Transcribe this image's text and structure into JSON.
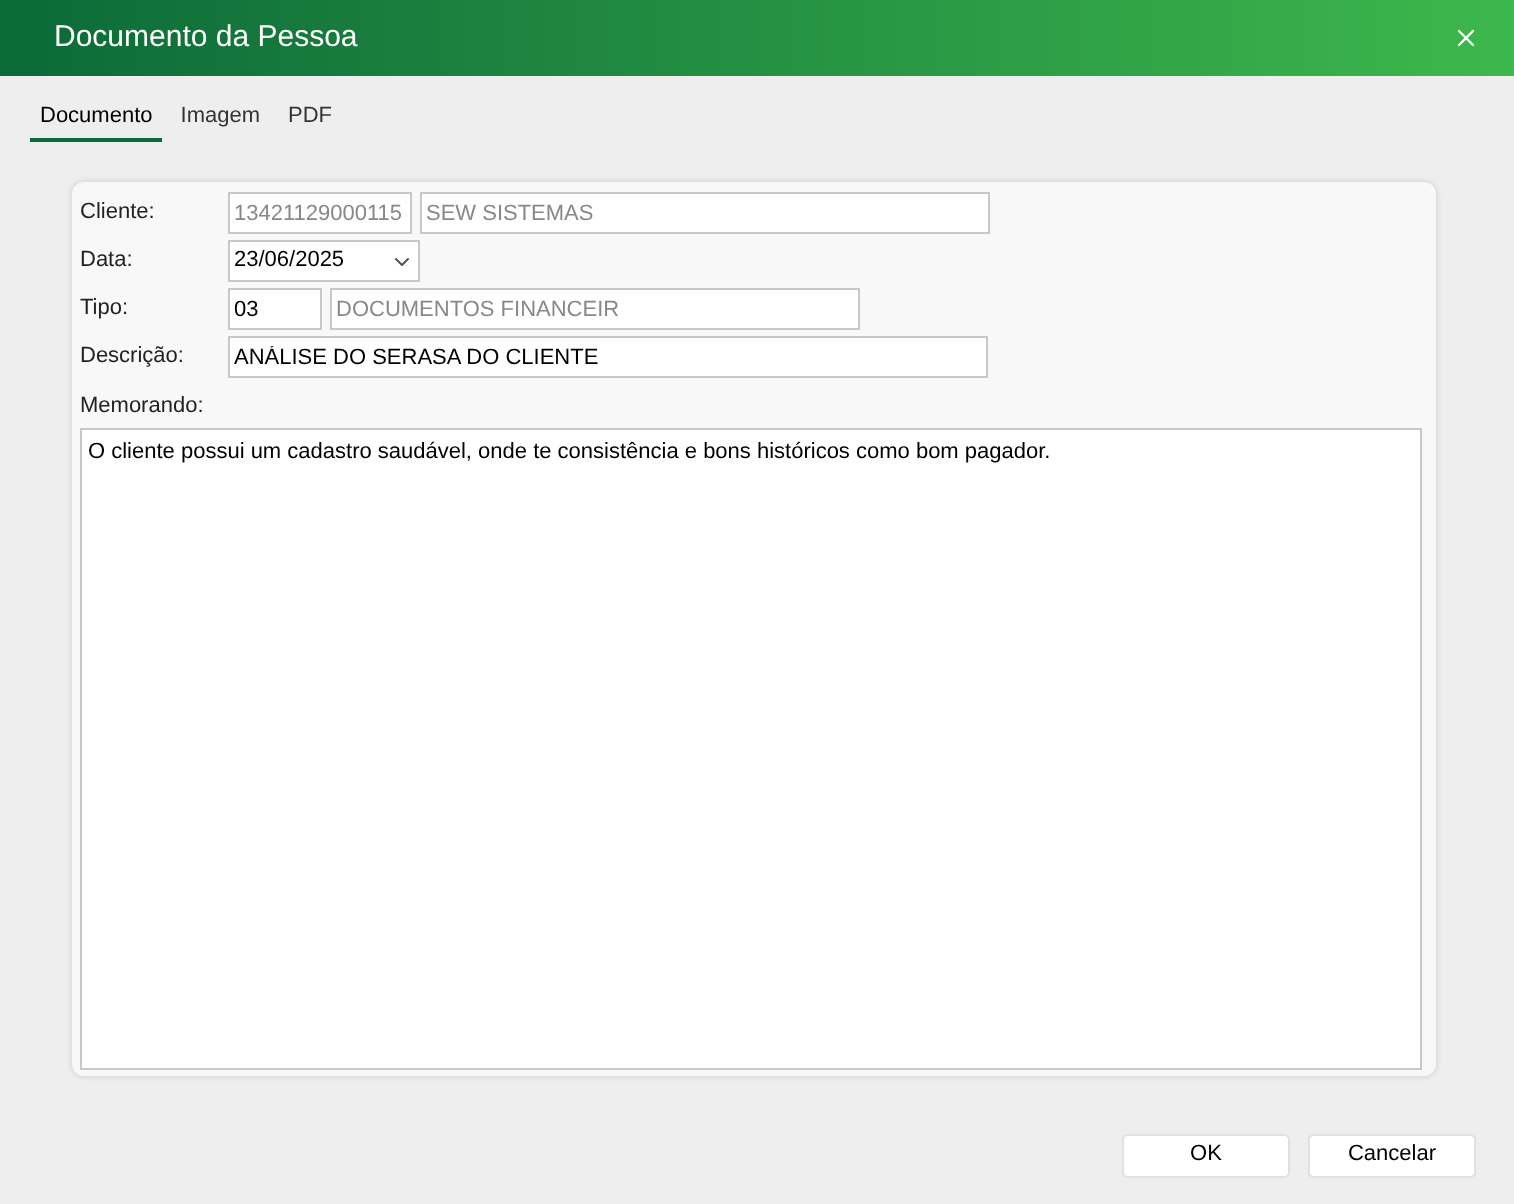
{
  "window": {
    "title": "Documento da Pessoa"
  },
  "tabs": [
    {
      "label": "Documento",
      "selected": true
    },
    {
      "label": "Imagem",
      "selected": false
    },
    {
      "label": "PDF",
      "selected": false
    }
  ],
  "form": {
    "rows": [
      {
        "label": "Cliente:",
        "fields": [
          {
            "kind": "text",
            "value": "13421129000115",
            "disabled": true
          },
          {
            "kind": "text",
            "value": "SEW SISTEMAS",
            "disabled": true
          }
        ]
      },
      {
        "label": "Data:",
        "fields": [
          {
            "kind": "date",
            "value": "23/06/2025",
            "disabled": false
          }
        ]
      },
      {
        "label": "Tipo:",
        "fields": [
          {
            "kind": "text",
            "value": "03",
            "disabled": false
          },
          {
            "kind": "text",
            "value": "DOCUMENTOS FINANCEIR",
            "disabled": true
          }
        ]
      },
      {
        "label": "Descrição:",
        "fields": [
          {
            "kind": "text",
            "value": "ANÁLISE DO SERASA DO CLIENTE",
            "disabled": false
          }
        ]
      }
    ],
    "memo": {
      "label": "Memorando:",
      "value": "O cliente possui um cadastro saudável, onde te consistência e bons históricos como bom pagador."
    }
  },
  "buttons": [
    {
      "label": "OK"
    },
    {
      "label": "Cancelar"
    }
  ]
}
